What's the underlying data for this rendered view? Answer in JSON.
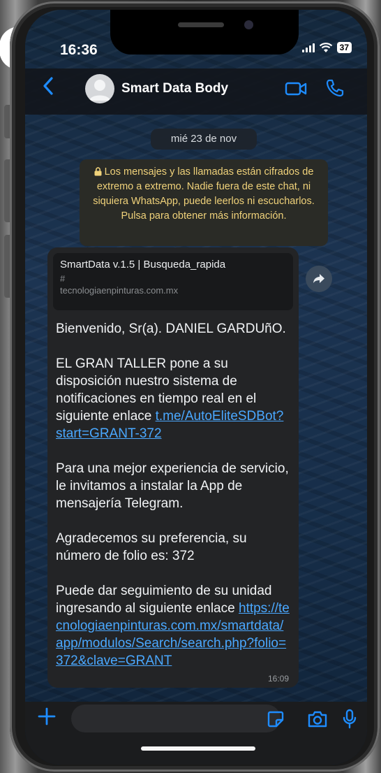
{
  "background_text": "e",
  "status_bar": {
    "time": "16:36",
    "battery": "37"
  },
  "header": {
    "contact_name": "Smart Data Body"
  },
  "date_separator": "mié 23 de nov",
  "encryption_note": "Los mensajes y las llamadas están cifrados de extremo a extremo. Nadie fuera de este chat, ni siquiera WhatsApp, puede leerlos ni escucharlos. Pulsa para obtener más información.",
  "message": {
    "link_preview": {
      "title": "SmartData v.1.5 | Busqueda_rapida",
      "hash": "#",
      "domain": "tecnologiaenpinturas.com.mx"
    },
    "greeting": "Bienvenido, Sr(a). DANIEL GARDUñO.",
    "paragraph1": " EL GRAN TALLER pone a su disposición nuestro sistema de notificaciones en tiempo real en el siguiente enlace ",
    "link1": "t.me/AutoEliteSDBot?start=GRANT-372",
    "paragraph2": "Para una mejor experiencia de servicio, le invitamos a instalar la App de mensajería Telegram.",
    "paragraph3": "Agradecemos su preferencia, su número de folio es: 372",
    "paragraph4": "Puede dar seguimiento de su unidad ingresando al siguiente enlace ",
    "link2": "https://tecnologiaenpinturas.com.mx/smartdata/app/modulos/Search/search.php?folio=372&clave=GRANT",
    "time": "16:09"
  },
  "colors": {
    "accent": "#1e8cff",
    "link": "#4aa8ff",
    "encryption_text": "#f0d27a"
  }
}
